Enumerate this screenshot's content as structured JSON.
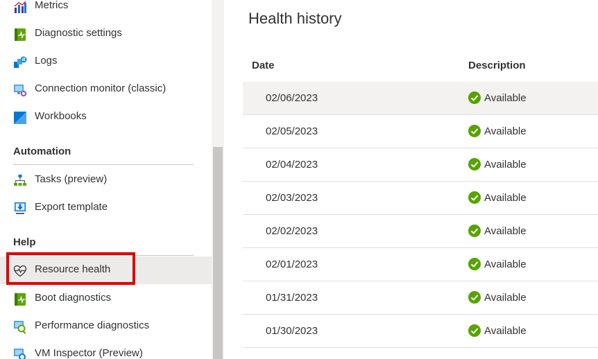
{
  "sidebar": {
    "items_top": [
      {
        "label": "Metrics",
        "icon": "metrics-icon"
      },
      {
        "label": "Diagnostic settings",
        "icon": "diagnostic-settings-icon"
      },
      {
        "label": "Logs",
        "icon": "logs-icon"
      },
      {
        "label": "Connection monitor (classic)",
        "icon": "connection-monitor-icon"
      },
      {
        "label": "Workbooks",
        "icon": "workbooks-icon"
      }
    ],
    "automation": {
      "header": "Automation",
      "items": [
        {
          "label": "Tasks (preview)",
          "icon": "tasks-icon"
        },
        {
          "label": "Export template",
          "icon": "export-template-icon"
        }
      ]
    },
    "help": {
      "header": "Help",
      "items": [
        {
          "label": "Resource health",
          "icon": "heart-pulse-icon",
          "selected": true
        },
        {
          "label": "Boot diagnostics",
          "icon": "boot-diagnostics-icon"
        },
        {
          "label": "Performance diagnostics",
          "icon": "performance-diagnostics-icon"
        },
        {
          "label": "VM Inspector (Preview)",
          "icon": "vm-inspector-icon"
        }
      ]
    }
  },
  "main": {
    "title": "Health history",
    "columns": {
      "date": "Date",
      "description": "Description"
    },
    "rows": [
      {
        "date": "02/06/2023",
        "description": "Available"
      },
      {
        "date": "02/05/2023",
        "description": "Available"
      },
      {
        "date": "02/04/2023",
        "description": "Available"
      },
      {
        "date": "02/03/2023",
        "description": "Available"
      },
      {
        "date": "02/02/2023",
        "description": "Available"
      },
      {
        "date": "02/01/2023",
        "description": "Available"
      },
      {
        "date": "01/31/2023",
        "description": "Available"
      },
      {
        "date": "01/30/2023",
        "description": "Available"
      }
    ]
  },
  "colors": {
    "selected_bg": "#edebe9",
    "highlight": "#e00000",
    "available_green": "#57a300"
  }
}
